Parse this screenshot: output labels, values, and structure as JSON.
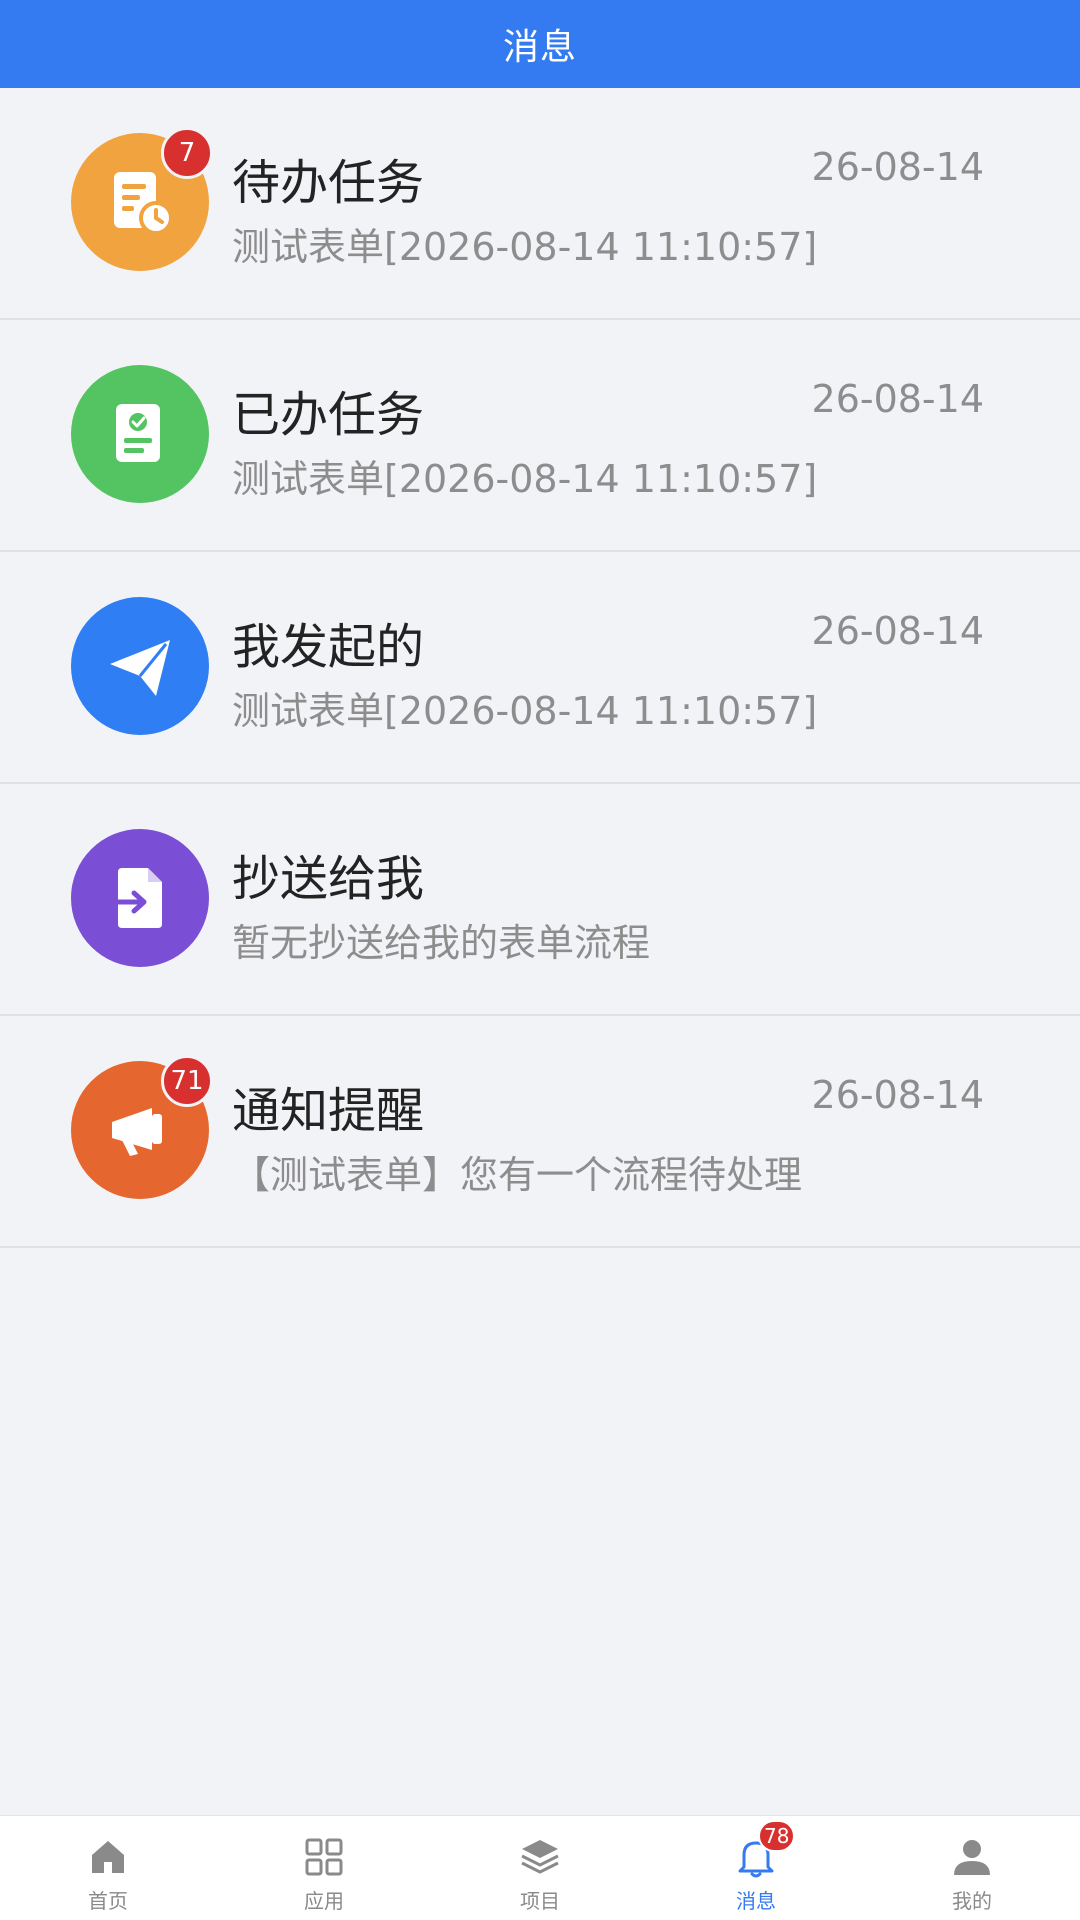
{
  "header": {
    "title": "消息"
  },
  "colors": {
    "primary": "#347bf2",
    "badge": "#d8302f",
    "todo": "#f0a33e",
    "done": "#53c461",
    "initiated": "#2f7ef3",
    "cc": "#7a4fd6",
    "notify": "#e5672f"
  },
  "messages": [
    {
      "icon": "todo-document-clock-icon",
      "title": "待办任务",
      "subtitle": "测试表单[2026-08-14 11:10:57]",
      "date": "26-08-14",
      "badge": "7"
    },
    {
      "icon": "completed-certificate-icon",
      "title": "已办任务",
      "subtitle": "测试表单[2026-08-14 11:10:57]",
      "date": "26-08-14",
      "badge": null
    },
    {
      "icon": "paper-plane-icon",
      "title": "我发起的",
      "subtitle": "测试表单[2026-08-14 11:10:57]",
      "date": "26-08-14",
      "badge": null
    },
    {
      "icon": "file-forward-icon",
      "title": "抄送给我",
      "subtitle": "暂无抄送给我的表单流程",
      "date": "",
      "badge": null
    },
    {
      "icon": "megaphone-icon",
      "title": "通知提醒",
      "subtitle": "【测试表单】您有一个流程待处理",
      "date": "26-08-14",
      "badge": "71"
    }
  ],
  "tabbar": {
    "items": [
      {
        "label": "首页",
        "icon": "home-icon"
      },
      {
        "label": "应用",
        "icon": "grid-icon"
      },
      {
        "label": "项目",
        "icon": "layers-icon"
      },
      {
        "label": "消息",
        "icon": "bell-icon",
        "badge": "78",
        "active": true
      },
      {
        "label": "我的",
        "icon": "user-icon"
      }
    ]
  }
}
